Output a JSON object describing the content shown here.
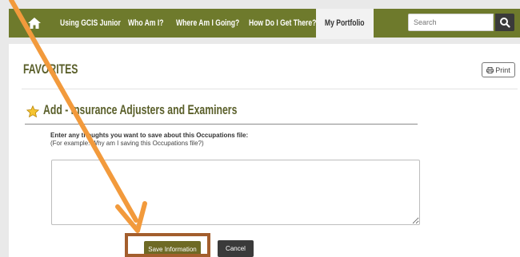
{
  "nav": {
    "home_icon": "home-icon",
    "items": [
      {
        "label": "Using GCIS Junior"
      },
      {
        "label": "Who Am I?"
      },
      {
        "label": "Where Am I Going?"
      },
      {
        "label": "How Do I Get There?"
      }
    ],
    "active": {
      "label": "My Portfolio"
    },
    "search": {
      "placeholder": "Search",
      "icon": "search-icon"
    }
  },
  "page": {
    "title": "FAVORITES",
    "print_label": "Print",
    "section_title": "Add - Insurance Adjusters and Examiners",
    "instructions": {
      "line1": "Enter any thoughts you want to save about this Occupations file:",
      "line2": "(For example: Why am I saving this Occupations file?)"
    },
    "notes_value": "",
    "save_label": "Save Information",
    "cancel_label": "Cancel"
  },
  "colors": {
    "nav_bg": "#6e7a2c",
    "title_color": "#5a5f2a",
    "save_bg": "#6e6a25",
    "cancel_bg": "#3a3a3a",
    "annotation_arrow": "#f29a3c",
    "annotation_box": "#a35e2d"
  }
}
